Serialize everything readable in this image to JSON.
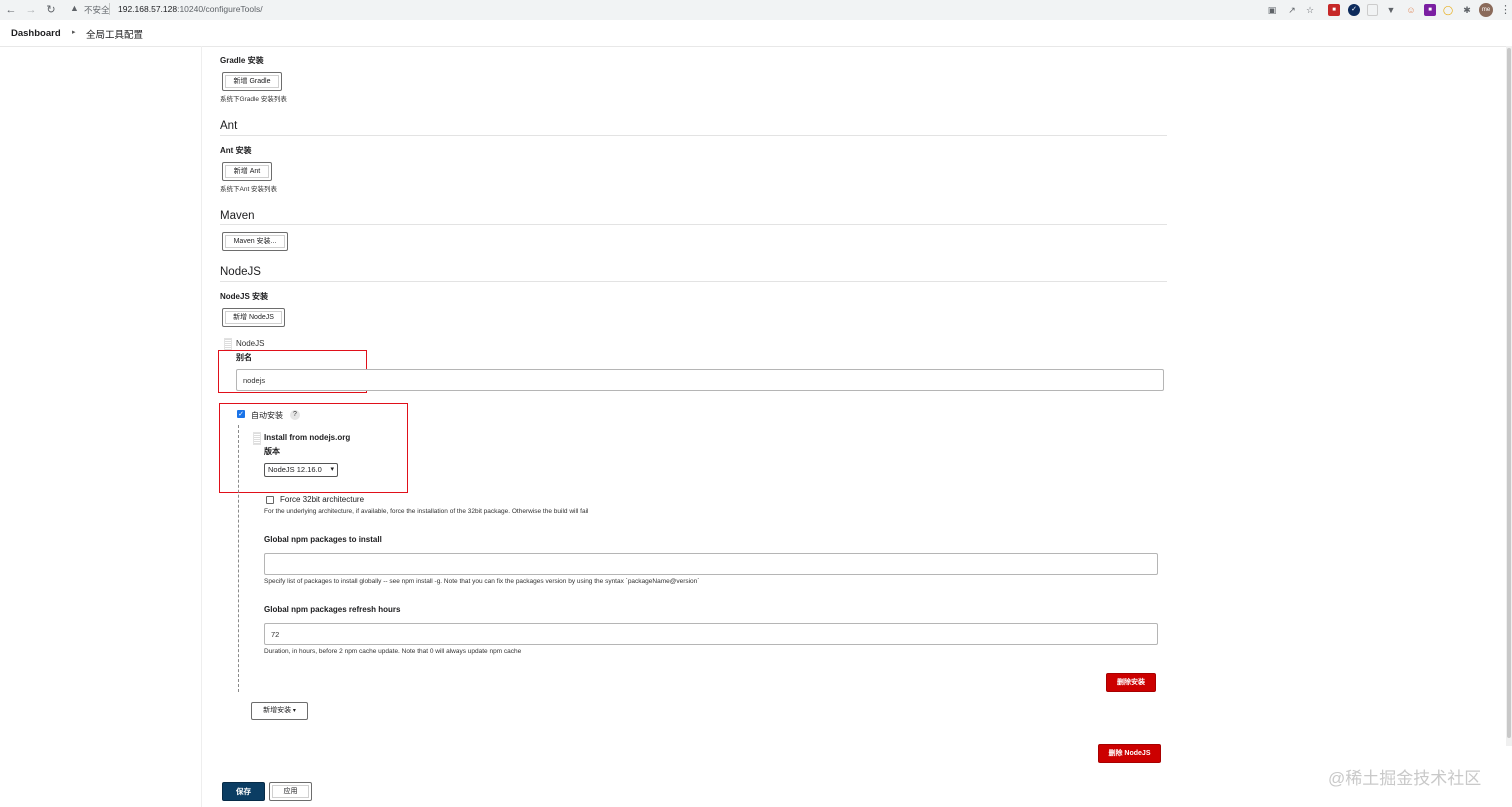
{
  "browser": {
    "security_text": "不安全",
    "url_host": "192.168.57.128",
    "url_path": ":10240/configureTools/",
    "avatar_text": "me"
  },
  "breadcrumb": {
    "dashboard": "Dashboard",
    "current": "全局工具配置"
  },
  "gradle": {
    "install_label": "Gradle 安装",
    "add_button": "新增 Gradle",
    "help": "系统下Gradle 安装列表"
  },
  "ant": {
    "title": "Ant",
    "install_label": "Ant 安装",
    "add_button": "新增 Ant",
    "help": "系统下Ant 安装列表"
  },
  "maven": {
    "title": "Maven",
    "install_button": "Maven 安装..."
  },
  "nodejs": {
    "title": "NodeJS",
    "install_label": "NodeJS 安装",
    "add_button": "新增 NodeJS",
    "item_header": "NodeJS",
    "alias_label": "别名",
    "alias_value": "nodejs",
    "auto_install_label": "自动安装",
    "auto_install_checked": true,
    "help_q": "?",
    "installer_title": "Install from nodejs.org",
    "version_label": "版本",
    "version_value": "NodeJS 12.16.0",
    "force32_label": "Force 32bit architecture",
    "force32_checked": false,
    "force32_help": "For the underlying architecture, if available, force the installation of the 32bit package. Otherwise the build will fail",
    "npm_packages_label": "Global npm packages to install",
    "npm_packages_value": "",
    "npm_packages_help": "Specify list of packages to install globally -- see npm install -g. Note that you can fix the packages version by using the syntax `packageName@version`",
    "refresh_label": "Global npm packages refresh hours",
    "refresh_value": "72",
    "refresh_help": "Duration, in hours, before 2 npm cache update. Note that 0 will always update npm cache",
    "delete_installer_button": "删除安装",
    "add_installer_button": "新增安装",
    "delete_nodejs_button": "删除 NodeJS"
  },
  "footer": {
    "save_button": "保存",
    "apply_button": "应用"
  },
  "watermark": "@稀土掘金技术社区",
  "colors": {
    "danger": "#cc0000",
    "primary": "#0b3d63",
    "annotation": "#e0101a"
  }
}
